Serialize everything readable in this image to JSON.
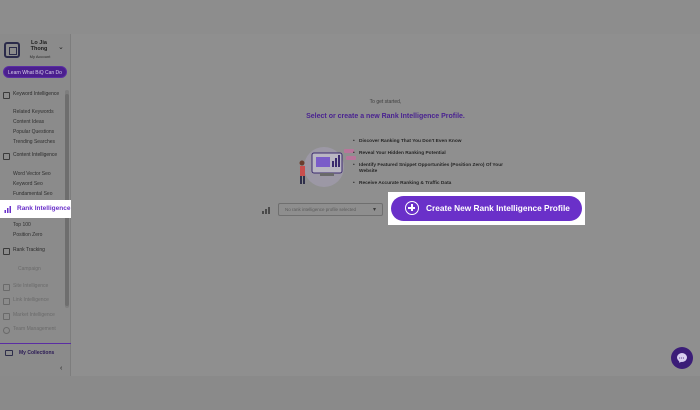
{
  "account": {
    "name": "Lo Jia Thong",
    "subtitle": "My Account",
    "chevron": "chevron-down-icon"
  },
  "sidebar": {
    "learn_button": "Learn What BiQ Can Do",
    "sections": {
      "keyword_intelligence": {
        "label": "Keyword Intelligence",
        "items": [
          "Related Keywords",
          "Content Ideas",
          "Popular Questions",
          "Trending Searches"
        ]
      },
      "content_intelligence": {
        "label": "Content Intelligence",
        "items": [
          "Word Vector Seo",
          "Keyword Seo",
          "Fundamental Seo"
        ]
      },
      "rank_intelligence": {
        "label": "Rank Intelligence",
        "items": [
          "Top 100",
          "Position Zero"
        ]
      },
      "rank_tracking": {
        "label": "Rank Tracking",
        "sub": "Campaign"
      },
      "site_intelligence": {
        "label": "Site Intelligence"
      },
      "link_intelligence": {
        "label": "Link Intelligence"
      },
      "market_intelligence": {
        "label": "Market Intelligence"
      },
      "team_management": {
        "label": "Team Management"
      }
    },
    "collections_label": "My Collections",
    "collapse_glyph": "‹"
  },
  "main": {
    "get_started": "To get started,",
    "headline": "Select or create a new Rank Intelligence Profile.",
    "bullets": [
      "Discover Ranking That You Don't Even Know",
      "Reveal Your Hidden Ranking Potential",
      "Identify Featured Snippet Opportunities (Position Zero) Of Your Website",
      "Receive Accurate Ranking & Traffic Data"
    ],
    "profile_select": {
      "text": "No rank intelligence profile selected",
      "chevron": "▾"
    },
    "create_button": "Create New Rank Intelligence Profile"
  },
  "colors": {
    "accent": "#6a30c9",
    "dark_accent": "#4b1f8e",
    "highlight": "#ffffff"
  },
  "icons": [
    "rank-intelligence-icon",
    "plus-circle-icon",
    "chat-icon",
    "collections-icon",
    "bar-chart-icon"
  ]
}
